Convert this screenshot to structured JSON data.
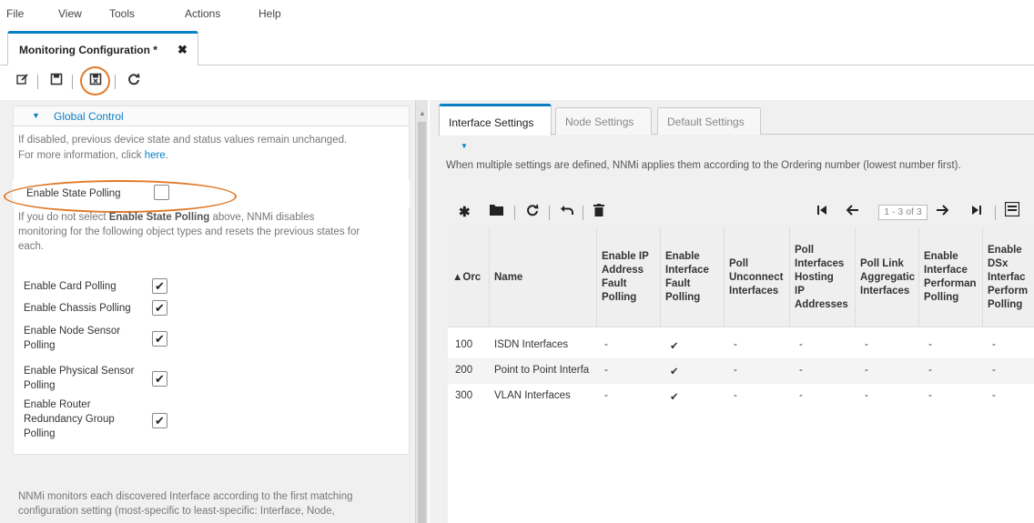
{
  "menu": [
    "File",
    "View",
    "Tools",
    "Actions",
    "Help"
  ],
  "doc_tab": {
    "label": "Monitoring Configuration *",
    "close": "✖"
  },
  "global_control": {
    "title": "Global Control",
    "disabled_note": "If disabled, previous device state and status values remain unchanged.",
    "more_info_prefix": "For more information, click ",
    "more_info_link": "here",
    "more_info_suffix": ".",
    "enable_state_polling": {
      "label": "Enable State Polling",
      "checked": false
    },
    "note_prefix": "If you do not select ",
    "note_bold": "Enable State Polling",
    "note_line1_suffix": " above, NNMi disables",
    "note_line2": "monitoring for the following object types and resets the previous states for",
    "note_line3": "each.",
    "options": [
      {
        "label_lines": [
          "Enable Card Polling"
        ],
        "checked": true
      },
      {
        "label_lines": [
          "Enable Chassis Polling"
        ],
        "checked": true
      },
      {
        "label_lines": [
          "Enable Node Sensor",
          "Polling"
        ],
        "checked": true
      },
      {
        "label_lines": [
          "Enable Physical Sensor",
          "Polling"
        ],
        "checked": true
      },
      {
        "label_lines": [
          "Enable Router",
          "Redundancy Group",
          "Polling"
        ],
        "checked": true
      }
    ],
    "footer_line1": "NNMi monitors each discovered Interface according to the first matching",
    "footer_line2": "configuration setting (most-specific to least-specific: Interface, Node,"
  },
  "right_tabs": [
    "Interface Settings",
    "Node Settings",
    "Default Settings"
  ],
  "info_text": "When multiple settings are defined, NNMi applies them according to the Ordering number (lowest number first).",
  "pager": {
    "range": "1 - 3 of 3"
  },
  "columns": [
    {
      "lines": [
        "▲Orc"
      ]
    },
    {
      "lines": [
        "Name"
      ]
    },
    {
      "lines": [
        "Enable IP",
        "Address",
        "Fault",
        "Polling"
      ]
    },
    {
      "lines": [
        "Enable",
        "Interface",
        "Fault",
        "Polling"
      ]
    },
    {
      "lines": [
        "Poll",
        "Unconnect",
        "Interfaces"
      ]
    },
    {
      "lines": [
        "Poll",
        "Interfaces",
        "Hosting",
        "IP",
        "Addresses"
      ]
    },
    {
      "lines": [
        "Poll Link",
        "Aggregatic",
        "Interfaces"
      ]
    },
    {
      "lines": [
        "Enable",
        "Interface",
        "Performan",
        "Polling"
      ]
    },
    {
      "lines": [
        "Enable",
        "DSx",
        "Interfac",
        "Perform",
        "Polling"
      ]
    }
  ],
  "rows": [
    [
      "100",
      "ISDN Interfaces",
      "-",
      "✔",
      "-",
      "-",
      "-",
      "-",
      "-"
    ],
    [
      "200",
      "Point to Point Interfa",
      "-",
      "✔",
      "-",
      "-",
      "-",
      "-",
      "-"
    ],
    [
      "300",
      "VLAN Interfaces",
      "-",
      "✔",
      "-",
      "-",
      "-",
      "-",
      "-"
    ]
  ],
  "colors": {
    "accent": "#0a7fc4",
    "highlight": "#e07a2a"
  }
}
